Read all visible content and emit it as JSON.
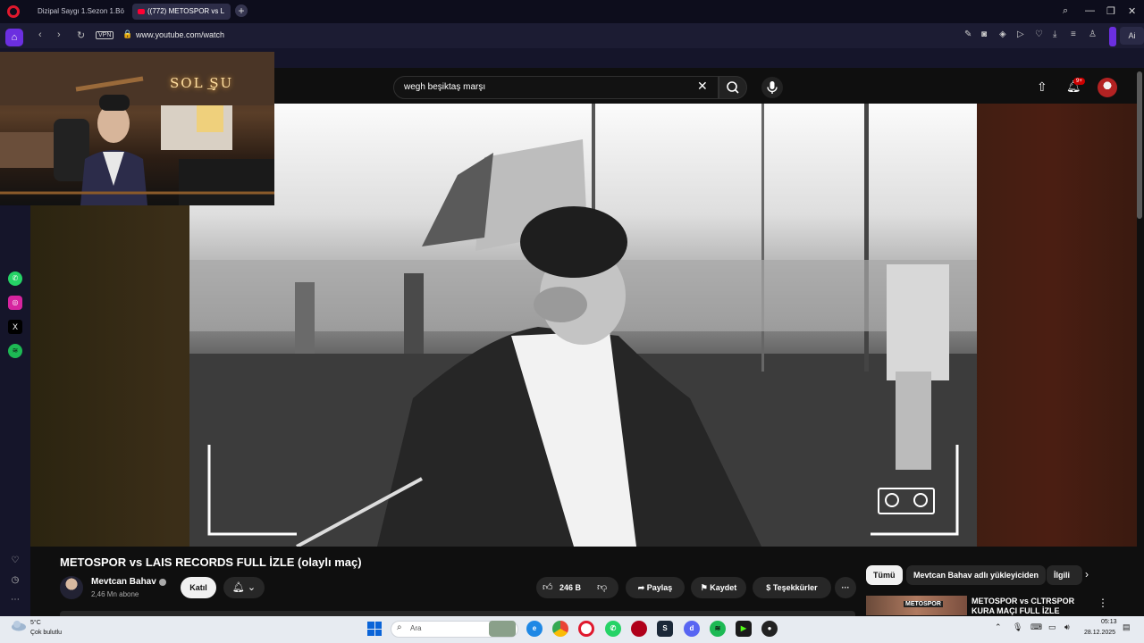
{
  "browser": {
    "tabs": [
      {
        "label": "Dizipal Saygı 1.Sezon 1.Bö"
      },
      {
        "label": "((772) METOSPOR vs L"
      }
    ],
    "new_tab_symbol": "+",
    "url": "www.youtube.com/watch",
    "vpn_label": "VPN",
    "ai_label": "Ai"
  },
  "youtube": {
    "search_query": "wegh beşiktaş marşı",
    "notifications_badge": "9+",
    "video_title": "METOSPOR vs LAIS RECORDS FULL İZLE (olaylı maç)",
    "channel_name": "Mevtcan Bahav",
    "subscribers": "2,46 Mn abone",
    "join_label": "Katıl",
    "likes": "246 B",
    "share_label": "Paylaş",
    "save_label": "Kaydet",
    "thanks_label": "Teşekkürler",
    "more_label": "···",
    "chips": [
      "Tümü",
      "Mevtcan Bahav adlı yükleyiciden",
      "İlgili"
    ],
    "recommended": [
      {
        "title": "METOSPOR vs CLTRSPOR KURA MAÇI FULL İZLE",
        "thumb_badge": "METOSPOR"
      }
    ]
  },
  "webcam": {
    "neon_sign": "SOL ͟ŞU"
  },
  "taskbar": {
    "temperature": "5°C",
    "weather": "Çok bulutlu",
    "search_placeholder": "Ara",
    "time": "05:13",
    "date": "28.12.2025"
  },
  "colors": {
    "accent_purple": "#6b2fe0",
    "opera_red": "#e0182d",
    "youtube_red": "#ff0033"
  }
}
